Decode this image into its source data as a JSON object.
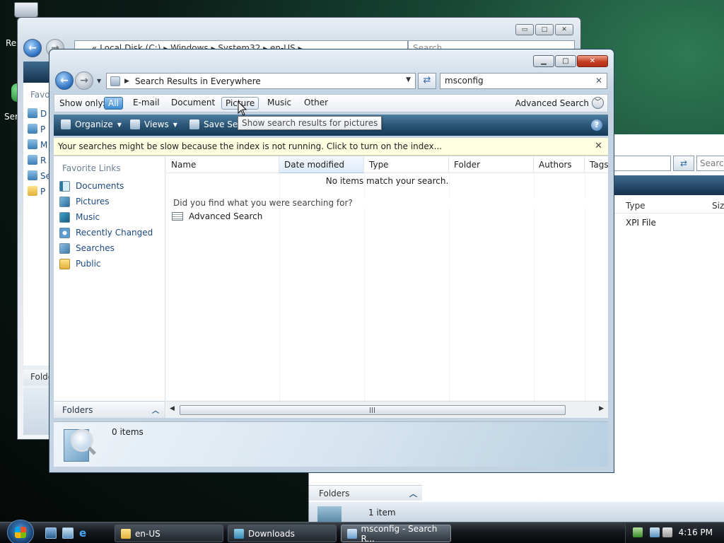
{
  "desktop": {
    "recycle_label": "Re",
    "server_label": "Ser"
  },
  "back_window_1": {
    "address": "«  Local Disk (C:)  ▸  Windows  ▸  System32  ▸  en-US  ▸",
    "search_placeholder": "Search",
    "sidebar_title": "Favo",
    "sidebar_items": [
      "D",
      "P",
      "M",
      "R",
      "Se",
      "P"
    ],
    "folders_label": "Folde"
  },
  "back_window_2": {
    "search_placeholder": "Search",
    "columns": [
      "Type",
      "Size"
    ],
    "row_type": "XPI File",
    "folders_label": "Folders",
    "status": "1 item"
  },
  "main_window": {
    "address": "Search Results in Everywhere",
    "search_value": "msconfig",
    "show_only_label": "Show only:",
    "filters": [
      "All",
      "E-mail",
      "Document",
      "Picture",
      "Music",
      "Other"
    ],
    "advanced_search_label": "Advanced Search",
    "toolbar": {
      "organize": "Organize",
      "views": "Views",
      "save_search": "Save Sea"
    },
    "tooltip": "Show search results for pictures",
    "infobar": "Your searches might be slow because the index is not running.  Click to turn on the index...",
    "favorite_links_title": "Favorite Links",
    "favorite_links": [
      "Documents",
      "Pictures",
      "Music",
      "Recently Changed",
      "Searches",
      "Public"
    ],
    "folders_label": "Folders",
    "columns": [
      "Name",
      "Date modified",
      "Type",
      "Folder",
      "Authors",
      "Tags"
    ],
    "empty_message": "No items match your search.",
    "did_you_find": "Did you find what you were searching for?",
    "advanced_search_link": "Advanced Search",
    "status_count": "0 items"
  },
  "taskbar": {
    "buttons": [
      "en-US",
      "Downloads",
      "msconfig - Search R..."
    ],
    "clock": "4:16 PM"
  }
}
